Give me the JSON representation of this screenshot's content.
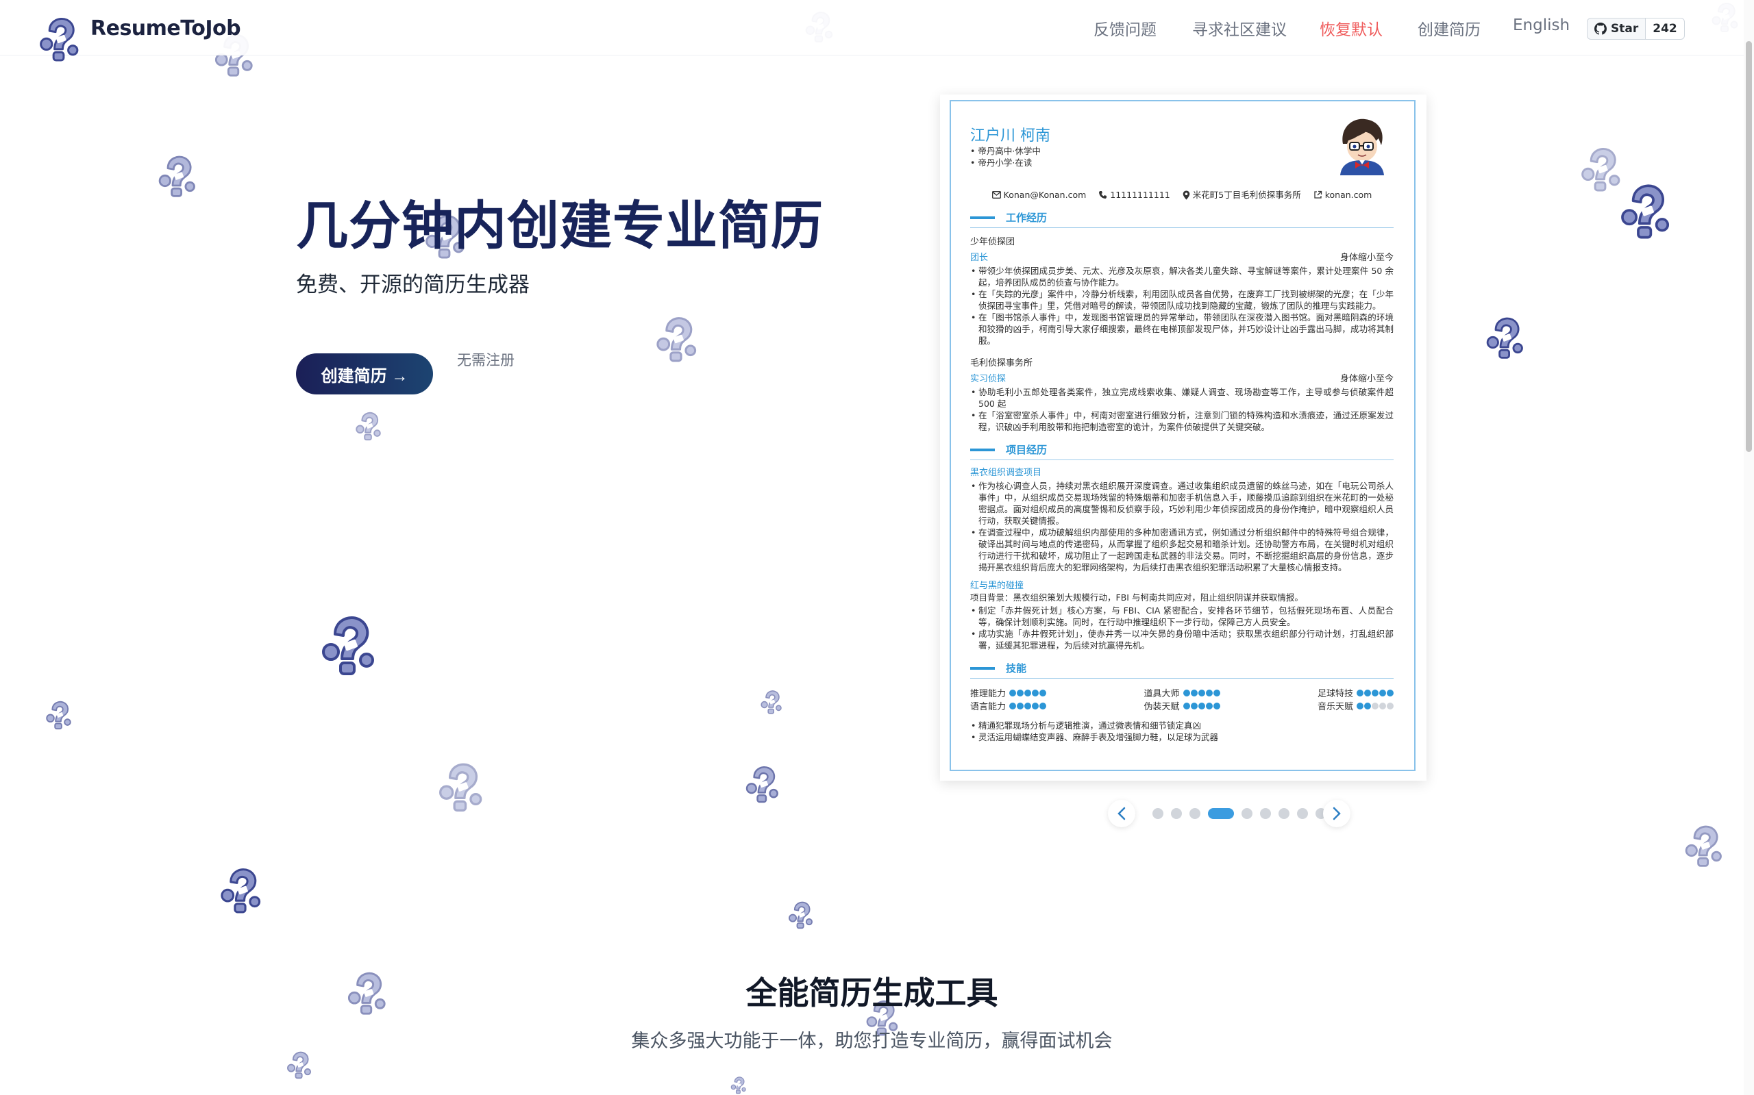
{
  "nav": {
    "brand": "ResumeToJob",
    "links": [
      {
        "label": "反馈问题",
        "id": "feedback"
      },
      {
        "label": "寻求社区建议",
        "id": "community"
      },
      {
        "label": "恢复默认",
        "id": "reset"
      },
      {
        "label": "创建简历",
        "id": "create"
      },
      {
        "label": "English",
        "id": "lang"
      }
    ],
    "github": {
      "label": "Star",
      "count": "242"
    }
  },
  "hero": {
    "title": "几分钟内创建专业简历",
    "subtitle": "免费、开源的简历生成器",
    "cta": "创建简历 →",
    "note": "无需注册"
  },
  "resume": {
    "name": "江户川 柯南",
    "tags": [
      "帝丹高中·休学中",
      "帝丹小学·在读"
    ],
    "contact": {
      "email": "Konan@Konan.com",
      "phone": "11111111111",
      "address": "米花町5丁目毛利侦探事务所",
      "site": "konan.com"
    },
    "sections": {
      "work": "工作经历",
      "projects": "项目经历",
      "skills": "技能"
    },
    "work": [
      {
        "org": "少年侦探团",
        "role": "团长",
        "date": "身体缩小至今",
        "bullets": [
          "带领少年侦探团成员步美、元太、光彦及灰原哀，解决各类儿童失踪、寻宝解谜等案件，累计处理案件 50 余起，培养团队成员的侦查与协作能力。",
          "在「失踪的光彦」案件中，冷静分析线索，利用团队成员各自优势，在废弃工厂找到被绑架的光彦；在「少年侦探团寻宝事件」里，凭借对暗号的解读，带领团队成功找到隐藏的宝藏，锻炼了团队的推理与实践能力。",
          "在「图书馆杀人事件」中，发现图书馆管理员的异常举动，带领团队在深夜潜入图书馆。面对黑暗阴森的环境和狡猾的凶手，柯南引导大家仔细搜索，最终在电梯顶部发现尸体，并巧妙设计让凶手露出马脚，成功将其制服。"
        ]
      },
      {
        "org": "毛利侦探事务所",
        "role": "实习侦探",
        "date": "身体缩小至今",
        "bullets": [
          "协助毛利小五郎处理各类案件，独立完成线索收集、嫌疑人调查、现场勘查等工作，主导或参与侦破案件超 500 起",
          "在「浴室密室杀人事件」中，柯南对密室进行细致分析，注意到门锁的特殊构造和水渍痕迹，通过还原案发过程，识破凶手利用胶带和拖把制造密室的诡计，为案件侦破提供了关键突破。"
        ]
      }
    ],
    "projects": [
      {
        "title": "黑衣组织调查项目",
        "intro": "",
        "bullets": [
          "作为核心调查人员，持续对黑衣组织展开深度调查。通过收集组织成员遗留的蛛丝马迹，如在「电玩公司杀人事件」中，从组织成员交易现场残留的特殊烟蒂和加密手机信息入手，顺藤摸瓜追踪到组织在米花町的一处秘密据点。面对组织成员的高度警惕和反侦察手段，巧妙利用少年侦探团成员的身份作掩护，暗中观察组织人员行动，获取关键情报。",
          "在调查过程中，成功破解组织内部使用的多种加密通讯方式，例如通过分析组织邮件中的特殊符号组合规律，破译出其时间与地点的传递密码，从而掌握了组织多起交易和暗杀计划。还协助警方布局，在关键时机对组织行动进行干扰和破坏，成功阻止了一起跨国走私武器的非法交易。同时，不断挖掘组织高层的身份信息，逐步揭开黑衣组织背后庞大的犯罪网络架构，为后续打击黑衣组织犯罪活动积累了大量核心情报支持。"
        ]
      },
      {
        "title": "红与黑的碰撞",
        "intro": "项目背景：黑衣组织策划大规模行动，FBI 与柯南共同应对，阻止组织阴谋并获取情报。",
        "bullets": [
          "制定「赤井假死计划」核心方案，与 FBI、CIA 紧密配合，安排各环节细节，包括假死现场布置、人员配合等，确保计划顺利实施。同时，在行动中推理组织下一步行动，保障己方人员安全。",
          "成功实施「赤井假死计划」，使赤井秀一以冲矢昴的身份暗中活动；获取黑衣组织部分行动计划，打乱组织部署，延缓其犯罪进程，为后续对抗赢得先机。"
        ]
      }
    ],
    "skills": [
      {
        "name": "推理能力",
        "level": 5,
        "max": 5
      },
      {
        "name": "道具大师",
        "level": 5,
        "max": 5
      },
      {
        "name": "足球特技",
        "level": 5,
        "max": 5
      },
      {
        "name": "语言能力",
        "level": 5,
        "max": 5
      },
      {
        "name": "伪装天赋",
        "level": 5,
        "max": 5
      },
      {
        "name": "音乐天赋",
        "level": 2,
        "max": 5
      }
    ],
    "skill_notes": [
      "精通犯罪现场分析与逻辑推演，通过微表情和细节锁定真凶",
      "灵活运用蝴蝶结变声器、麻醉手表及增强脚力鞋，以足球为武器"
    ]
  },
  "carousel": {
    "total": 9,
    "active": 3,
    "prev_icon": "chevron-left-icon",
    "next_icon": "chevron-right-icon"
  },
  "features": {
    "title": "全能简历生成工具",
    "subtitle": "集众多强大功能于一体，助您打造专业简历，赢得面试机会"
  },
  "colors": {
    "accent": "#2c96d6",
    "brand": "#18245a",
    "reset": "#ef5a5a"
  }
}
